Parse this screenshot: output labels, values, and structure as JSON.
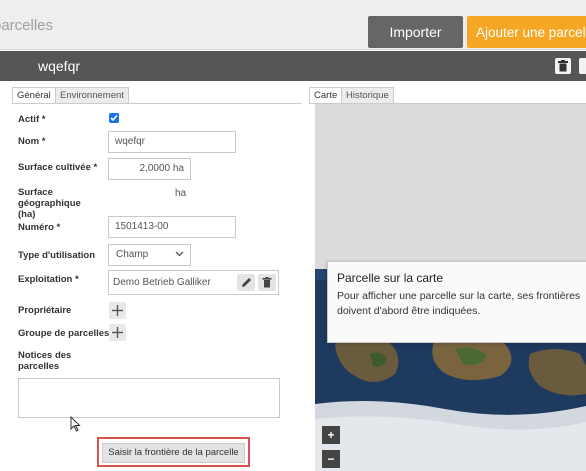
{
  "header": {
    "title": "parcelles",
    "import_label": "Importer",
    "add_label": "Ajouter une parcelle"
  },
  "record": {
    "name": "wqefqr"
  },
  "left_tabs": [
    {
      "label": "Général",
      "active": true
    },
    {
      "label": "Environnement",
      "active": false
    }
  ],
  "right_tabs": [
    {
      "label": "Carte",
      "active": true
    },
    {
      "label": "Historique",
      "active": false
    }
  ],
  "form": {
    "actif": {
      "label": "Actif *",
      "checked": true
    },
    "nom": {
      "label": "Nom *",
      "value": "wqefqr"
    },
    "surface_cultivee": {
      "label": "Surface cultivée *",
      "value": "2,0000 ha"
    },
    "surface_geo": {
      "label": "Surface géographique (ha)",
      "unit": "ha"
    },
    "numero": {
      "label": "Numéro *",
      "value": "1501413-00"
    },
    "type_utilisation": {
      "label": "Type d'utilisation",
      "selected": "Champ"
    },
    "exploitation": {
      "label": "Exploitation *",
      "value": "Demo Betrieb Galliker"
    },
    "proprietaire": {
      "label": "Propriétaire"
    },
    "groupe": {
      "label": "Groupe de parcelles"
    },
    "notices": {
      "label": "Notices des parcelles"
    }
  },
  "boundary_button_label": "Saisir la frontière de la parcelle",
  "map": {
    "tooltip_title": "Parcelle sur la carte",
    "tooltip_body": "Pour afficher une parcelle sur la carte, ses frontières doivent d'abord être indiquées.",
    "zoom_in": "+",
    "zoom_out": "−"
  },
  "colors": {
    "accent": "#f5a623",
    "import_button": "#666666",
    "record_header": "#555555",
    "highlight_border": "#d9534f",
    "checkbox": "#1a73e8"
  },
  "icons": {
    "trash": "trash-icon",
    "pencil": "pencil-icon",
    "plus": "plus-icon",
    "chevron": "chevron-down-icon",
    "check": "check-icon"
  }
}
